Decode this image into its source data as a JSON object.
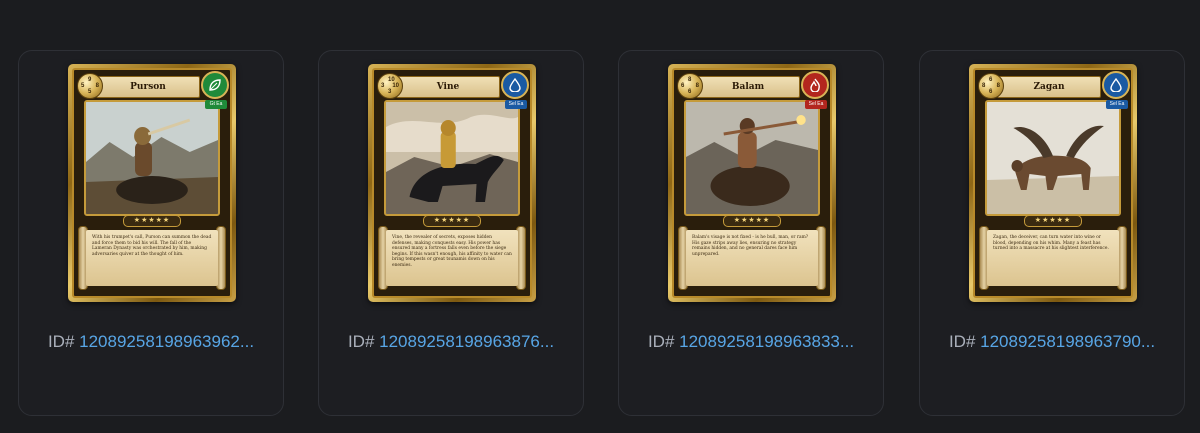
{
  "cards": [
    {
      "name": "Purson",
      "stats": {
        "top": "9",
        "left": "5",
        "right": "8",
        "bottom": "5"
      },
      "element": {
        "icon": "leaf-icon",
        "color": "#1f8a3a",
        "tag": "Gt Ea"
      },
      "stars": "★★★★★",
      "description": "With his trumpet's call, Purson can summon the dead and force them to bid his will. The fall of the Lameran Dynasty was orchestrated by him, making adversaries quiver at the thought of him.",
      "id_prefix": "ID#",
      "id_value": "12089258198963962..."
    },
    {
      "name": "Vine",
      "stats": {
        "top": "10",
        "left": "3",
        "right": "10",
        "bottom": "3"
      },
      "element": {
        "icon": "water-drop-icon",
        "color": "#1a5aa3",
        "tag": "Sel Ea"
      },
      "stars": "★★★★★",
      "description": "Vine, the revealer of secrets, exposes hidden defenses, making conquests easy. His power has ensured many a fortress falls even before the siege begins. If this wasn't enough, his affinity to water can bring tempests or great tsunamis down on his enemies.",
      "id_prefix": "ID#",
      "id_value": "12089258198963876..."
    },
    {
      "name": "Balam",
      "stats": {
        "top": "8",
        "left": "6",
        "right": "8",
        "bottom": "6"
      },
      "element": {
        "icon": "flame-icon",
        "color": "#b3261e",
        "tag": "Sel Ea"
      },
      "stars": "★★★★★",
      "description": "Balam's visage is not fixed - is he bull, man, or ram? His gaze strips away lies, ensuring no strategy remains hidden, and no general dares face him unprepared.",
      "id_prefix": "ID#",
      "id_value": "12089258198963833..."
    },
    {
      "name": "Zagan",
      "stats": {
        "top": "6",
        "left": "8",
        "right": "8",
        "bottom": "6"
      },
      "element": {
        "icon": "water-drop-icon",
        "color": "#1a5aa3",
        "tag": "Sel Ea"
      },
      "stars": "★★★★★",
      "description": "Zagan, the deceiver, can turn water into wine or blood, depending on his whim. Many a feast has turned into a massacre at his slightest interference.",
      "id_prefix": "ID#",
      "id_value": "12089258198963790..."
    }
  ]
}
